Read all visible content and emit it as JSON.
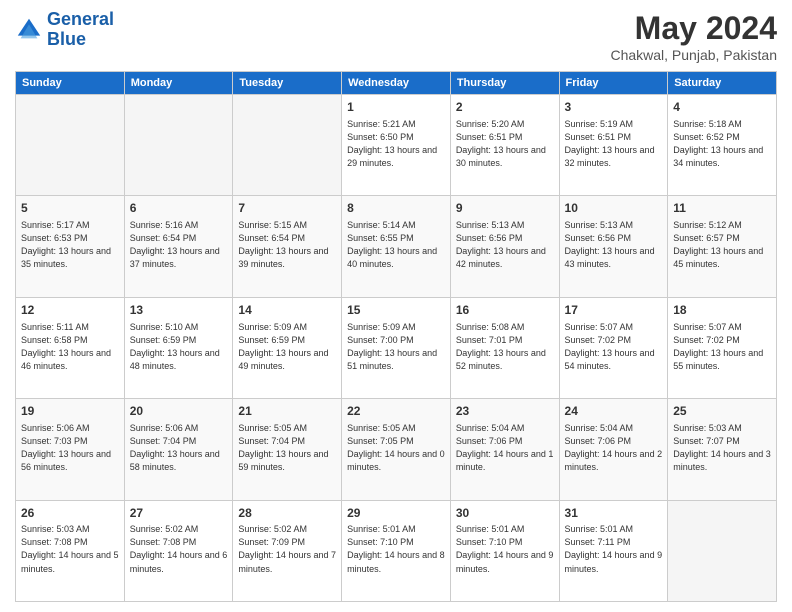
{
  "logo": {
    "line1": "General",
    "line2": "Blue"
  },
  "title": "May 2024",
  "subtitle": "Chakwal, Punjab, Pakistan",
  "headers": [
    "Sunday",
    "Monday",
    "Tuesday",
    "Wednesday",
    "Thursday",
    "Friday",
    "Saturday"
  ],
  "weeks": [
    [
      {
        "day": "",
        "sunrise": "",
        "sunset": "",
        "daylight": ""
      },
      {
        "day": "",
        "sunrise": "",
        "sunset": "",
        "daylight": ""
      },
      {
        "day": "",
        "sunrise": "",
        "sunset": "",
        "daylight": ""
      },
      {
        "day": "1",
        "sunrise": "Sunrise: 5:21 AM",
        "sunset": "Sunset: 6:50 PM",
        "daylight": "Daylight: 13 hours and 29 minutes."
      },
      {
        "day": "2",
        "sunrise": "Sunrise: 5:20 AM",
        "sunset": "Sunset: 6:51 PM",
        "daylight": "Daylight: 13 hours and 30 minutes."
      },
      {
        "day": "3",
        "sunrise": "Sunrise: 5:19 AM",
        "sunset": "Sunset: 6:51 PM",
        "daylight": "Daylight: 13 hours and 32 minutes."
      },
      {
        "day": "4",
        "sunrise": "Sunrise: 5:18 AM",
        "sunset": "Sunset: 6:52 PM",
        "daylight": "Daylight: 13 hours and 34 minutes."
      }
    ],
    [
      {
        "day": "5",
        "sunrise": "Sunrise: 5:17 AM",
        "sunset": "Sunset: 6:53 PM",
        "daylight": "Daylight: 13 hours and 35 minutes."
      },
      {
        "day": "6",
        "sunrise": "Sunrise: 5:16 AM",
        "sunset": "Sunset: 6:54 PM",
        "daylight": "Daylight: 13 hours and 37 minutes."
      },
      {
        "day": "7",
        "sunrise": "Sunrise: 5:15 AM",
        "sunset": "Sunset: 6:54 PM",
        "daylight": "Daylight: 13 hours and 39 minutes."
      },
      {
        "day": "8",
        "sunrise": "Sunrise: 5:14 AM",
        "sunset": "Sunset: 6:55 PM",
        "daylight": "Daylight: 13 hours and 40 minutes."
      },
      {
        "day": "9",
        "sunrise": "Sunrise: 5:13 AM",
        "sunset": "Sunset: 6:56 PM",
        "daylight": "Daylight: 13 hours and 42 minutes."
      },
      {
        "day": "10",
        "sunrise": "Sunrise: 5:13 AM",
        "sunset": "Sunset: 6:56 PM",
        "daylight": "Daylight: 13 hours and 43 minutes."
      },
      {
        "day": "11",
        "sunrise": "Sunrise: 5:12 AM",
        "sunset": "Sunset: 6:57 PM",
        "daylight": "Daylight: 13 hours and 45 minutes."
      }
    ],
    [
      {
        "day": "12",
        "sunrise": "Sunrise: 5:11 AM",
        "sunset": "Sunset: 6:58 PM",
        "daylight": "Daylight: 13 hours and 46 minutes."
      },
      {
        "day": "13",
        "sunrise": "Sunrise: 5:10 AM",
        "sunset": "Sunset: 6:59 PM",
        "daylight": "Daylight: 13 hours and 48 minutes."
      },
      {
        "day": "14",
        "sunrise": "Sunrise: 5:09 AM",
        "sunset": "Sunset: 6:59 PM",
        "daylight": "Daylight: 13 hours and 49 minutes."
      },
      {
        "day": "15",
        "sunrise": "Sunrise: 5:09 AM",
        "sunset": "Sunset: 7:00 PM",
        "daylight": "Daylight: 13 hours and 51 minutes."
      },
      {
        "day": "16",
        "sunrise": "Sunrise: 5:08 AM",
        "sunset": "Sunset: 7:01 PM",
        "daylight": "Daylight: 13 hours and 52 minutes."
      },
      {
        "day": "17",
        "sunrise": "Sunrise: 5:07 AM",
        "sunset": "Sunset: 7:02 PM",
        "daylight": "Daylight: 13 hours and 54 minutes."
      },
      {
        "day": "18",
        "sunrise": "Sunrise: 5:07 AM",
        "sunset": "Sunset: 7:02 PM",
        "daylight": "Daylight: 13 hours and 55 minutes."
      }
    ],
    [
      {
        "day": "19",
        "sunrise": "Sunrise: 5:06 AM",
        "sunset": "Sunset: 7:03 PM",
        "daylight": "Daylight: 13 hours and 56 minutes."
      },
      {
        "day": "20",
        "sunrise": "Sunrise: 5:06 AM",
        "sunset": "Sunset: 7:04 PM",
        "daylight": "Daylight: 13 hours and 58 minutes."
      },
      {
        "day": "21",
        "sunrise": "Sunrise: 5:05 AM",
        "sunset": "Sunset: 7:04 PM",
        "daylight": "Daylight: 13 hours and 59 minutes."
      },
      {
        "day": "22",
        "sunrise": "Sunrise: 5:05 AM",
        "sunset": "Sunset: 7:05 PM",
        "daylight": "Daylight: 14 hours and 0 minutes."
      },
      {
        "day": "23",
        "sunrise": "Sunrise: 5:04 AM",
        "sunset": "Sunset: 7:06 PM",
        "daylight": "Daylight: 14 hours and 1 minute."
      },
      {
        "day": "24",
        "sunrise": "Sunrise: 5:04 AM",
        "sunset": "Sunset: 7:06 PM",
        "daylight": "Daylight: 14 hours and 2 minutes."
      },
      {
        "day": "25",
        "sunrise": "Sunrise: 5:03 AM",
        "sunset": "Sunset: 7:07 PM",
        "daylight": "Daylight: 14 hours and 3 minutes."
      }
    ],
    [
      {
        "day": "26",
        "sunrise": "Sunrise: 5:03 AM",
        "sunset": "Sunset: 7:08 PM",
        "daylight": "Daylight: 14 hours and 5 minutes."
      },
      {
        "day": "27",
        "sunrise": "Sunrise: 5:02 AM",
        "sunset": "Sunset: 7:08 PM",
        "daylight": "Daylight: 14 hours and 6 minutes."
      },
      {
        "day": "28",
        "sunrise": "Sunrise: 5:02 AM",
        "sunset": "Sunset: 7:09 PM",
        "daylight": "Daylight: 14 hours and 7 minutes."
      },
      {
        "day": "29",
        "sunrise": "Sunrise: 5:01 AM",
        "sunset": "Sunset: 7:10 PM",
        "daylight": "Daylight: 14 hours and 8 minutes."
      },
      {
        "day": "30",
        "sunrise": "Sunrise: 5:01 AM",
        "sunset": "Sunset: 7:10 PM",
        "daylight": "Daylight: 14 hours and 9 minutes."
      },
      {
        "day": "31",
        "sunrise": "Sunrise: 5:01 AM",
        "sunset": "Sunset: 7:11 PM",
        "daylight": "Daylight: 14 hours and 9 minutes."
      },
      {
        "day": "",
        "sunrise": "",
        "sunset": "",
        "daylight": ""
      }
    ]
  ]
}
